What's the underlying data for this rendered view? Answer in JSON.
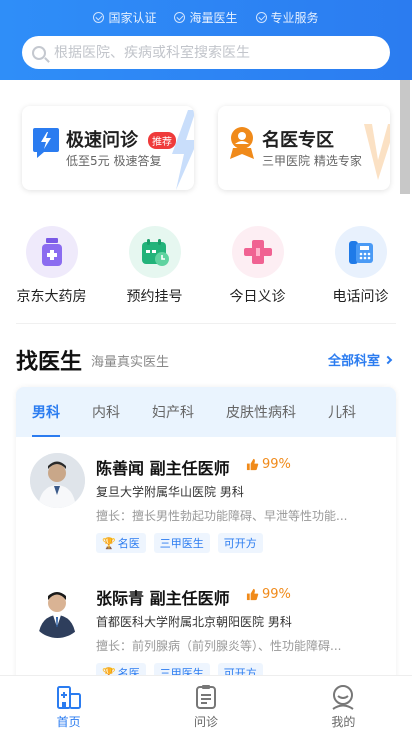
{
  "header": {
    "badges": [
      "国家认证",
      "海量医生",
      "专业服务"
    ],
    "search_placeholder": "根据医院、疾病或科室搜索医生"
  },
  "cards": [
    {
      "title": "极速问诊",
      "subtitle": "低至5元 极速答复",
      "tag": "推荐",
      "icon": "lightning-chat-icon",
      "color": "#2b7cf0"
    },
    {
      "title": "名医专区",
      "subtitle": "三甲医院 精选专家",
      "icon": "doctor-badge-icon",
      "color": "#f08a1a"
    }
  ],
  "quick_links": [
    {
      "label": "京东大药房",
      "icon": "pharmacy-bottle-icon",
      "bg": "#efeafb"
    },
    {
      "label": "预约挂号",
      "icon": "calendar-clock-icon",
      "bg": "#e6f7f0"
    },
    {
      "label": "今日义诊",
      "icon": "medical-cross-icon",
      "bg": "#fdeef3"
    },
    {
      "label": "电话问诊",
      "icon": "phone-icon",
      "bg": "#e8f1fd"
    }
  ],
  "section": {
    "title": "找医生",
    "subtitle": "海量真实医生",
    "link": "全部科室"
  },
  "dept_tabs": [
    "男科",
    "内科",
    "妇产科",
    "皮肤性病科",
    "儿科"
  ],
  "active_tab": 0,
  "doctors": [
    {
      "name": "陈善闻 副主任医师",
      "praise": "99%",
      "hospital": "复旦大学附属华山医院 男科",
      "good_at": "擅长：擅长男性勃起功能障碍、早泄等性功能...",
      "tags": [
        "名医",
        "三甲医生",
        "可开方"
      ]
    },
    {
      "name": "张际青 副主任医师",
      "praise": "99%",
      "hospital": "首都医科大学附属北京朝阳医院 男科",
      "good_at": "擅长：前列腺病（前列腺炎等）、性功能障碍...",
      "tags": [
        "名医",
        "三甲医生",
        "可开方"
      ]
    }
  ],
  "tabbar": [
    {
      "label": "首页",
      "icon": "home-hospital-icon",
      "active": true
    },
    {
      "label": "问诊",
      "icon": "clipboard-icon",
      "active": false
    },
    {
      "label": "我的",
      "icon": "user-icon",
      "active": false
    }
  ]
}
